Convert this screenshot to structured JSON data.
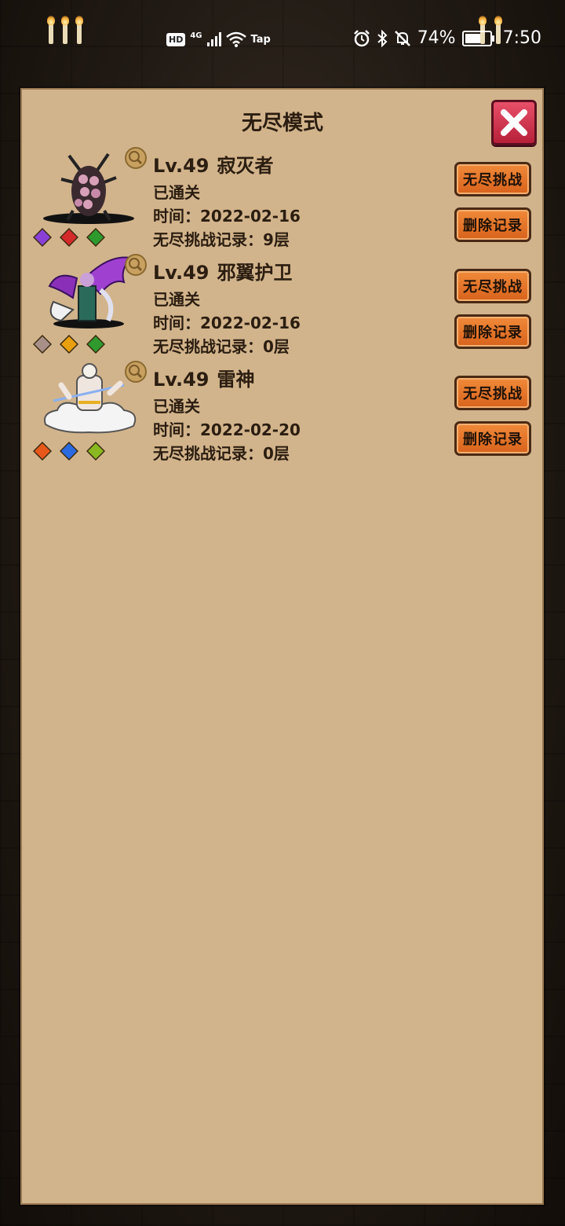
{
  "status_bar": {
    "hd": "HD",
    "network": "4G",
    "wifi_label": "Tap",
    "battery": "74%",
    "battery_level": 0.74,
    "time": "7:50"
  },
  "dialog": {
    "title": "无尽模式",
    "records": [
      {
        "level": "Lv.49",
        "name": "寂灭者",
        "status": "已通关",
        "time_label": "时间：",
        "time_value": "2022-02-16",
        "record_label": "无尽挑战记录：",
        "record_value": "9层",
        "gems": [
          "#8a3fd6",
          "#d42a2a",
          "#2e9a2e"
        ],
        "challenge_label": "无尽挑战",
        "delete_label": "删除记录"
      },
      {
        "level": "Lv.49",
        "name": "邪翼护卫",
        "status": "已通关",
        "time_label": "时间：",
        "time_value": "2022-02-16",
        "record_label": "无尽挑战记录：",
        "record_value": "0层",
        "gems": [
          "#a89088",
          "#e8a010",
          "#2e9a2e"
        ],
        "challenge_label": "无尽挑战",
        "delete_label": "删除记录"
      },
      {
        "level": "Lv.49",
        "name": "雷神",
        "status": "已通关",
        "time_label": "时间：",
        "time_value": "2022-02-20",
        "record_label": "无尽挑战记录：",
        "record_value": "0层",
        "gems": [
          "#e8581a",
          "#2a6ae0",
          "#8ab820"
        ],
        "challenge_label": "无尽挑战",
        "delete_label": "删除记录"
      }
    ]
  }
}
